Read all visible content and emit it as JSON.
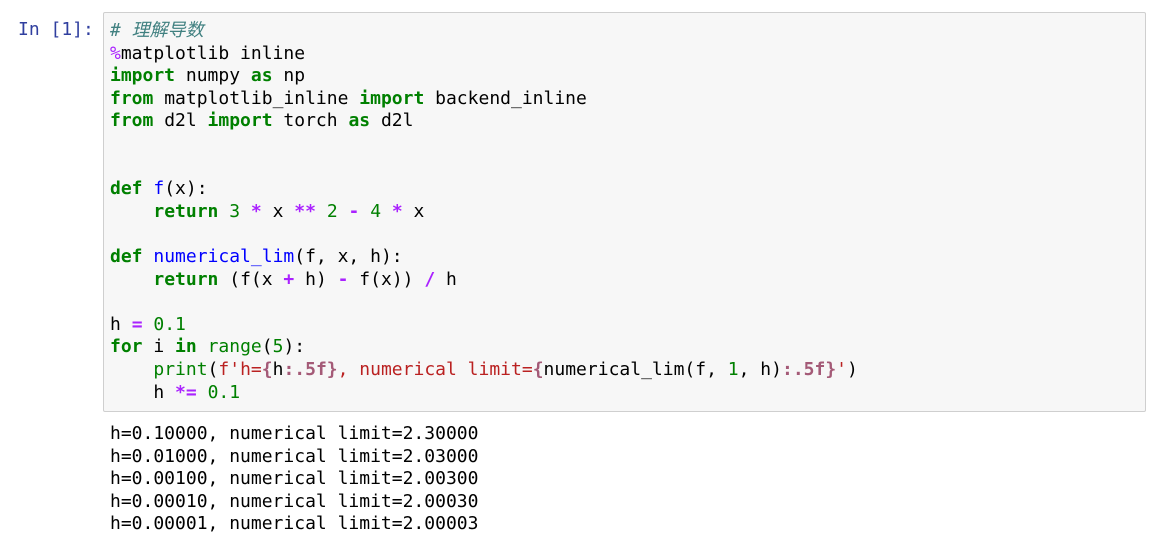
{
  "cell": {
    "prompt": "In [1]:",
    "code_lines": [
      [
        {
          "t": "comment",
          "v": "# 理解导数"
        }
      ],
      [
        {
          "t": "magic",
          "v": "%"
        },
        {
          "t": "plain",
          "v": "matplotlib inline"
        }
      ],
      [
        {
          "t": "keyword",
          "v": "import"
        },
        {
          "t": "plain",
          "v": " numpy "
        },
        {
          "t": "keyword",
          "v": "as"
        },
        {
          "t": "plain",
          "v": " np"
        }
      ],
      [
        {
          "t": "keyword",
          "v": "from"
        },
        {
          "t": "plain",
          "v": " matplotlib_inline "
        },
        {
          "t": "keyword",
          "v": "import"
        },
        {
          "t": "plain",
          "v": " backend_inline"
        }
      ],
      [
        {
          "t": "keyword",
          "v": "from"
        },
        {
          "t": "plain",
          "v": " d2l "
        },
        {
          "t": "keyword",
          "v": "import"
        },
        {
          "t": "plain",
          "v": " torch "
        },
        {
          "t": "keyword",
          "v": "as"
        },
        {
          "t": "plain",
          "v": " d2l"
        }
      ],
      [],
      [],
      [
        {
          "t": "keyword",
          "v": "def"
        },
        {
          "t": "plain",
          "v": " "
        },
        {
          "t": "func",
          "v": "f"
        },
        {
          "t": "plain",
          "v": "(x):"
        }
      ],
      [
        {
          "t": "plain",
          "v": "    "
        },
        {
          "t": "keyword",
          "v": "return"
        },
        {
          "t": "plain",
          "v": " "
        },
        {
          "t": "number",
          "v": "3"
        },
        {
          "t": "plain",
          "v": " "
        },
        {
          "t": "op",
          "v": "*"
        },
        {
          "t": "plain",
          "v": " x "
        },
        {
          "t": "op",
          "v": "**"
        },
        {
          "t": "plain",
          "v": " "
        },
        {
          "t": "number",
          "v": "2"
        },
        {
          "t": "plain",
          "v": " "
        },
        {
          "t": "op",
          "v": "-"
        },
        {
          "t": "plain",
          "v": " "
        },
        {
          "t": "number",
          "v": "4"
        },
        {
          "t": "plain",
          "v": " "
        },
        {
          "t": "op",
          "v": "*"
        },
        {
          "t": "plain",
          "v": " x"
        }
      ],
      [],
      [
        {
          "t": "keyword",
          "v": "def"
        },
        {
          "t": "plain",
          "v": " "
        },
        {
          "t": "func",
          "v": "numerical_lim"
        },
        {
          "t": "plain",
          "v": "(f, x, h):"
        }
      ],
      [
        {
          "t": "plain",
          "v": "    "
        },
        {
          "t": "keyword",
          "v": "return"
        },
        {
          "t": "plain",
          "v": " (f(x "
        },
        {
          "t": "op",
          "v": "+"
        },
        {
          "t": "plain",
          "v": " h) "
        },
        {
          "t": "op",
          "v": "-"
        },
        {
          "t": "plain",
          "v": " f(x)) "
        },
        {
          "t": "op",
          "v": "/"
        },
        {
          "t": "plain",
          "v": " h"
        }
      ],
      [],
      [
        {
          "t": "plain",
          "v": "h "
        },
        {
          "t": "op",
          "v": "="
        },
        {
          "t": "plain",
          "v": " "
        },
        {
          "t": "number",
          "v": "0.1"
        }
      ],
      [
        {
          "t": "keyword",
          "v": "for"
        },
        {
          "t": "plain",
          "v": " i "
        },
        {
          "t": "keyword",
          "v": "in"
        },
        {
          "t": "plain",
          "v": " "
        },
        {
          "t": "builtin",
          "v": "range"
        },
        {
          "t": "plain",
          "v": "("
        },
        {
          "t": "number",
          "v": "5"
        },
        {
          "t": "plain",
          "v": "):"
        }
      ],
      [
        {
          "t": "plain",
          "v": "    "
        },
        {
          "t": "builtin",
          "v": "print"
        },
        {
          "t": "plain",
          "v": "("
        },
        {
          "t": "string",
          "v": "f'h="
        },
        {
          "t": "interp",
          "v": "{"
        },
        {
          "t": "plain",
          "v": "h"
        },
        {
          "t": "interp",
          "v": ":.5f}"
        },
        {
          "t": "string",
          "v": ", numerical limit="
        },
        {
          "t": "interp",
          "v": "{"
        },
        {
          "t": "plain",
          "v": "numerical_lim(f, "
        },
        {
          "t": "number",
          "v": "1"
        },
        {
          "t": "plain",
          "v": ", h)"
        },
        {
          "t": "interp",
          "v": ":.5f}"
        },
        {
          "t": "string",
          "v": "'"
        },
        {
          "t": "plain",
          "v": ")"
        }
      ],
      [
        {
          "t": "plain",
          "v": "    h "
        },
        {
          "t": "op",
          "v": "*="
        },
        {
          "t": "plain",
          "v": " "
        },
        {
          "t": "number",
          "v": "0.1"
        }
      ]
    ],
    "output_lines": [
      "h=0.10000, numerical limit=2.30000",
      "h=0.01000, numerical limit=2.03000",
      "h=0.00100, numerical limit=2.00300",
      "h=0.00010, numerical limit=2.00030",
      "h=0.00001, numerical limit=2.00003"
    ]
  },
  "colors": {
    "prompt": "#303f9f",
    "cell_background": "#f7f7f7",
    "cell_border": "#cfcfcf",
    "keyword": "#008000",
    "operator": "#aa22ff",
    "string": "#ba2121",
    "function_name": "#0000ff",
    "comment": "#408080"
  }
}
